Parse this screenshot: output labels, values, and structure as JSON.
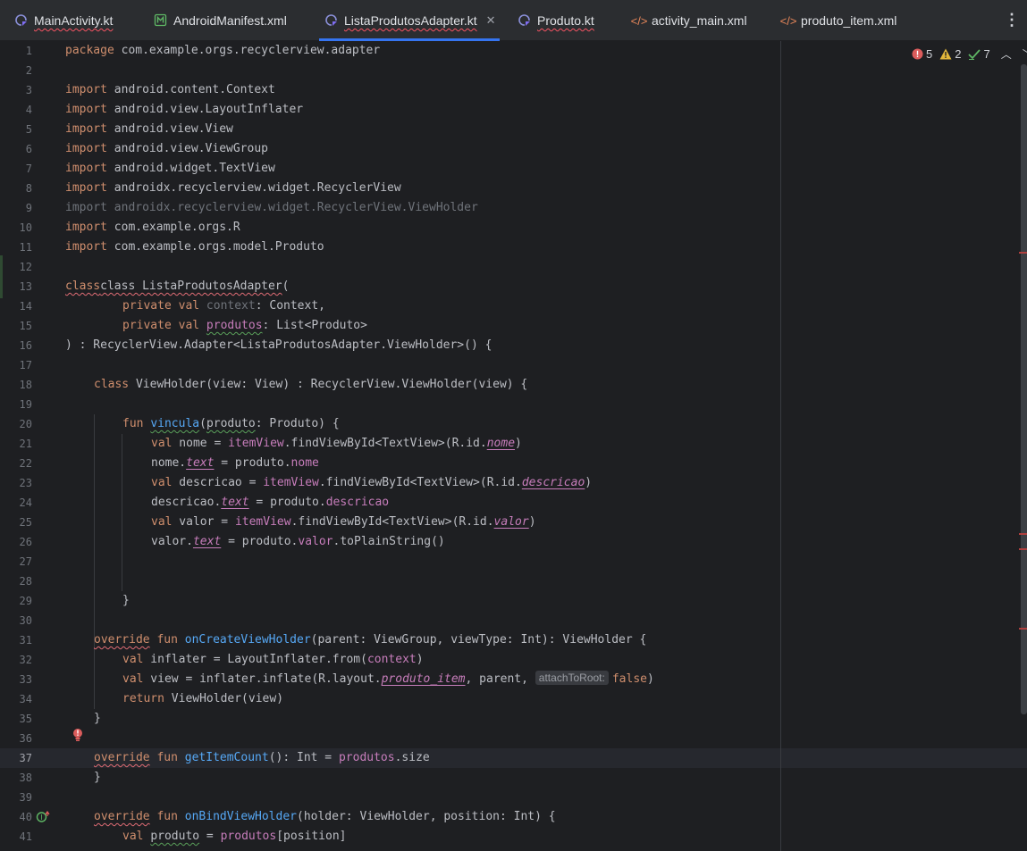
{
  "tabs": [
    {
      "label": "MainActivity.kt",
      "icon": "kotlin-file-icon",
      "active": false,
      "error": true
    },
    {
      "label": "AndroidManifest.xml",
      "icon": "manifest-file-icon",
      "active": false,
      "error": false
    },
    {
      "label": "ListaProdutosAdapter.kt",
      "icon": "kotlin-file-icon",
      "active": true,
      "error": true
    },
    {
      "label": "Produto.kt",
      "icon": "kotlin-file-icon",
      "active": false,
      "error": true
    },
    {
      "label": "activity_main.xml",
      "icon": "xml-file-icon",
      "active": false,
      "error": false
    },
    {
      "label": "produto_item.xml",
      "icon": "xml-file-icon",
      "active": false,
      "error": false
    }
  ],
  "inspections": {
    "errors": "5",
    "warnings": "2",
    "weak_warnings": "7"
  },
  "editor": {
    "current_line": 37,
    "line_numbers": [
      "1",
      "2",
      "3",
      "4",
      "5",
      "6",
      "7",
      "8",
      "9",
      "10",
      "11",
      "12",
      "13",
      "14",
      "15",
      "16",
      "17",
      "18",
      "19",
      "20",
      "21",
      "22",
      "23",
      "24",
      "25",
      "26",
      "27",
      "28",
      "29",
      "30",
      "31",
      "32",
      "33",
      "34",
      "35",
      "36",
      "37",
      "38",
      "39",
      "40",
      "41"
    ],
    "tokens": {
      "l1a": "package",
      "l1b": " com.example.orgs.recyclerview.adapter",
      "imp": "import",
      "l3": " android.content.Context",
      "l4": " android.view.LayoutInflater",
      "l5": " android.view.View",
      "l6": " android.view.ViewGroup",
      "l7": " android.widget.TextView",
      "l8": " androidx.recyclerview.widget.RecyclerView",
      "l9": "import androidx.recyclerview.widget.RecyclerView.ViewHolder",
      "l10": " com.example.orgs.R",
      "l11": " com.example.orgs.model.Produto",
      "l13a": "class ListaProdutosAdapter",
      "l13b": "(",
      "private_val": "private val",
      "l14a": "context",
      "l14b": ": Context,",
      "l15a": "produtos",
      "l15b": ": List<Produto>",
      "l16": ") : RecyclerView.Adapter<ListaProdutosAdapter.ViewHolder>() {",
      "class": "class",
      "l18": " ViewHolder(view: View) : RecyclerView.ViewHolder(view) {",
      "fun": "fun",
      "val": "val",
      "l20a": "vincula",
      "l20b": "(",
      "l20c": "produto",
      "l20d": ": Produto) {",
      "l21a": " nome = ",
      "itemView": "itemView",
      "l21b": ".findViewById<TextView>(R.id.",
      "nome": "nome",
      "close_paren": ")",
      "l22a": "nome.",
      "text": "text",
      "l22b": " = produto.",
      "l23a": " descricao = ",
      "descricao": "descricao",
      "l24a": "descricao.",
      "l25a": " valor = ",
      "valor": "valor",
      "l26a": "valor.",
      "l26b": ".toPlainString()",
      "close_brace": "}",
      "override": "override",
      "l31a": "onCreateViewHolder",
      "l31b": "(parent: ViewGroup, viewType: Int): ViewHolder {",
      "l32a": " inflater = LayoutInflater.from(",
      "l32b": "context",
      "l33a": " view = inflater.inflate(R.layout.",
      "l33b": "produto_item",
      "l33c": ", parent, ",
      "l33hint": "attachToRoot:",
      "l33d": "false",
      "return": "return",
      "l34": " ViewHolder(view)",
      "l37a": "getItemCount",
      "l37b": "(): Int = ",
      "produtos": "produtos",
      "l37c": ".size",
      "l40a": "onBindViewHolder",
      "l40b": "(holder: ViewHolder, position: Int) {",
      "l41a": "produto",
      "l41b": " = ",
      "l41c": "[position]"
    }
  }
}
